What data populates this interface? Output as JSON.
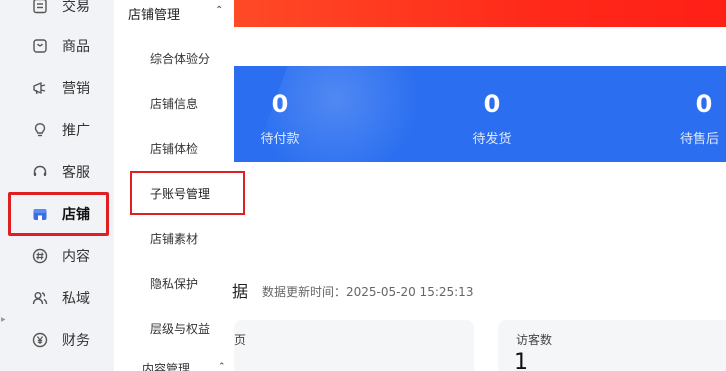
{
  "sidebar": {
    "items": [
      {
        "label": "交易",
        "icon": "document-icon"
      },
      {
        "label": "商品",
        "icon": "bag-icon"
      },
      {
        "label": "营销",
        "icon": "megaphone-icon"
      },
      {
        "label": "推广",
        "icon": "lightbulb-icon"
      },
      {
        "label": "客服",
        "icon": "headset-icon"
      },
      {
        "label": "店铺",
        "icon": "store-icon"
      },
      {
        "label": "内容",
        "icon": "hashtag-icon"
      },
      {
        "label": "私域",
        "icon": "users-icon"
      },
      {
        "label": "财务",
        "icon": "yen-icon"
      }
    ],
    "active": "店铺"
  },
  "submenu": {
    "header": "店铺管理",
    "items": [
      "综合体验分",
      "店铺信息",
      "店铺体检",
      "子账号管理",
      "店铺素材",
      "隐私保护",
      "层级与权益"
    ],
    "highlighted": "子账号管理",
    "footer": "内容管理"
  },
  "stats": [
    {
      "value": "0",
      "label": "待付款"
    },
    {
      "value": "0",
      "label": "待发货"
    },
    {
      "value": "0",
      "label": "待售后"
    }
  ],
  "data_section": {
    "title_fragment": "据",
    "update_time": "数据更新时间：2025-05-20 15:25:13"
  },
  "cards": [
    {
      "label_fragment": "页"
    },
    {
      "label": "访客数",
      "value": "1"
    }
  ],
  "colors": {
    "highlight_border": "#e02020",
    "banner_red": "#ff2a1a",
    "panel_blue": "#2b6ff0",
    "sidebar_bg": "#f2f3f7",
    "active_icon": "#3b6fe0"
  }
}
